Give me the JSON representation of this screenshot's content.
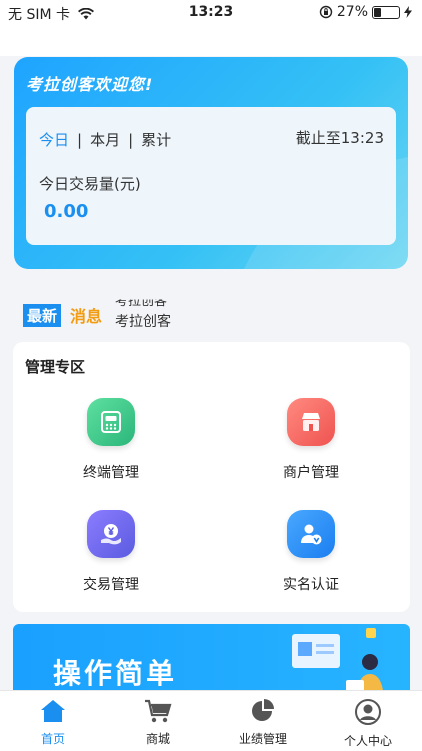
{
  "status_bar": {
    "carrier": "无 SIM 卡",
    "wifi_icon": "wifi-icon",
    "time": "13:23",
    "battery": "27%",
    "battery_level": 0.27
  },
  "hero": {
    "welcome": "考拉创客欢迎您!",
    "tabs": [
      "今日",
      "本月",
      "累计"
    ],
    "active_tab": "今日",
    "deadline": "截止至13:23",
    "volume_label": "今日交易量(元)",
    "volume_value": "0.00"
  },
  "news": {
    "badge_left": "最新",
    "badge_right": "消息",
    "text": "考拉创客"
  },
  "management": {
    "title": "管理专区",
    "items": [
      {
        "label": "终端管理",
        "icon": "terminal-icon"
      },
      {
        "label": "商户管理",
        "icon": "store-icon"
      },
      {
        "label": "交易管理",
        "icon": "yen-hand-icon"
      },
      {
        "label": "实名认证",
        "icon": "verified-user-icon"
      }
    ]
  },
  "banner": {
    "text": "操作简单"
  },
  "tabbar": {
    "items": [
      {
        "label": "首页",
        "icon": "home-icon"
      },
      {
        "label": "商城",
        "icon": "cart-icon"
      },
      {
        "label": "业绩管理",
        "icon": "pie-chart-icon"
      },
      {
        "label": "个人中心",
        "icon": "user-icon"
      }
    ],
    "active": "首页"
  },
  "colors": {
    "accent": "#1a8ff0",
    "news_orange": "#f39c12"
  }
}
